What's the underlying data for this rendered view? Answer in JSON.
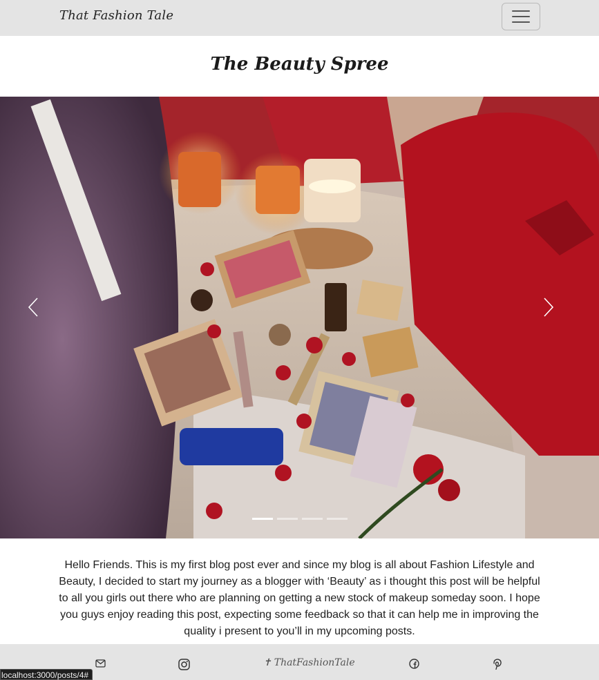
{
  "navbar": {
    "brand": "That Fashion Tale",
    "toggle_icon": "hamburger-icon"
  },
  "post": {
    "title": "The Beauty Spree",
    "intro": "Hello Friends. This is my first blog post ever and since my blog is all about Fashion Lifestyle and Beauty, I decided to start my journey as a blogger with ‘Beauty’ as i thought this post will be helpful to all you girls out there who are planning on getting a new stock of makeup someday soon. I hope you guys enjoy reading this post, expecting some feedback so that it can help me in improving the quality i present to you’ll in my upcoming posts."
  },
  "carousel": {
    "slide_count": 4,
    "active_index": 0,
    "prev_icon": "chevron-left-icon",
    "next_icon": "chevron-right-icon"
  },
  "footer": {
    "mail_icon": "mail-icon",
    "instagram_icon": "instagram-icon",
    "tag_glyph": "✝",
    "tag": "ThatFashionTale",
    "facebook_icon": "facebook-icon",
    "pinterest_icon": "pinterest-icon"
  },
  "status_bar": {
    "url": "localhost:3000/posts/4#"
  }
}
